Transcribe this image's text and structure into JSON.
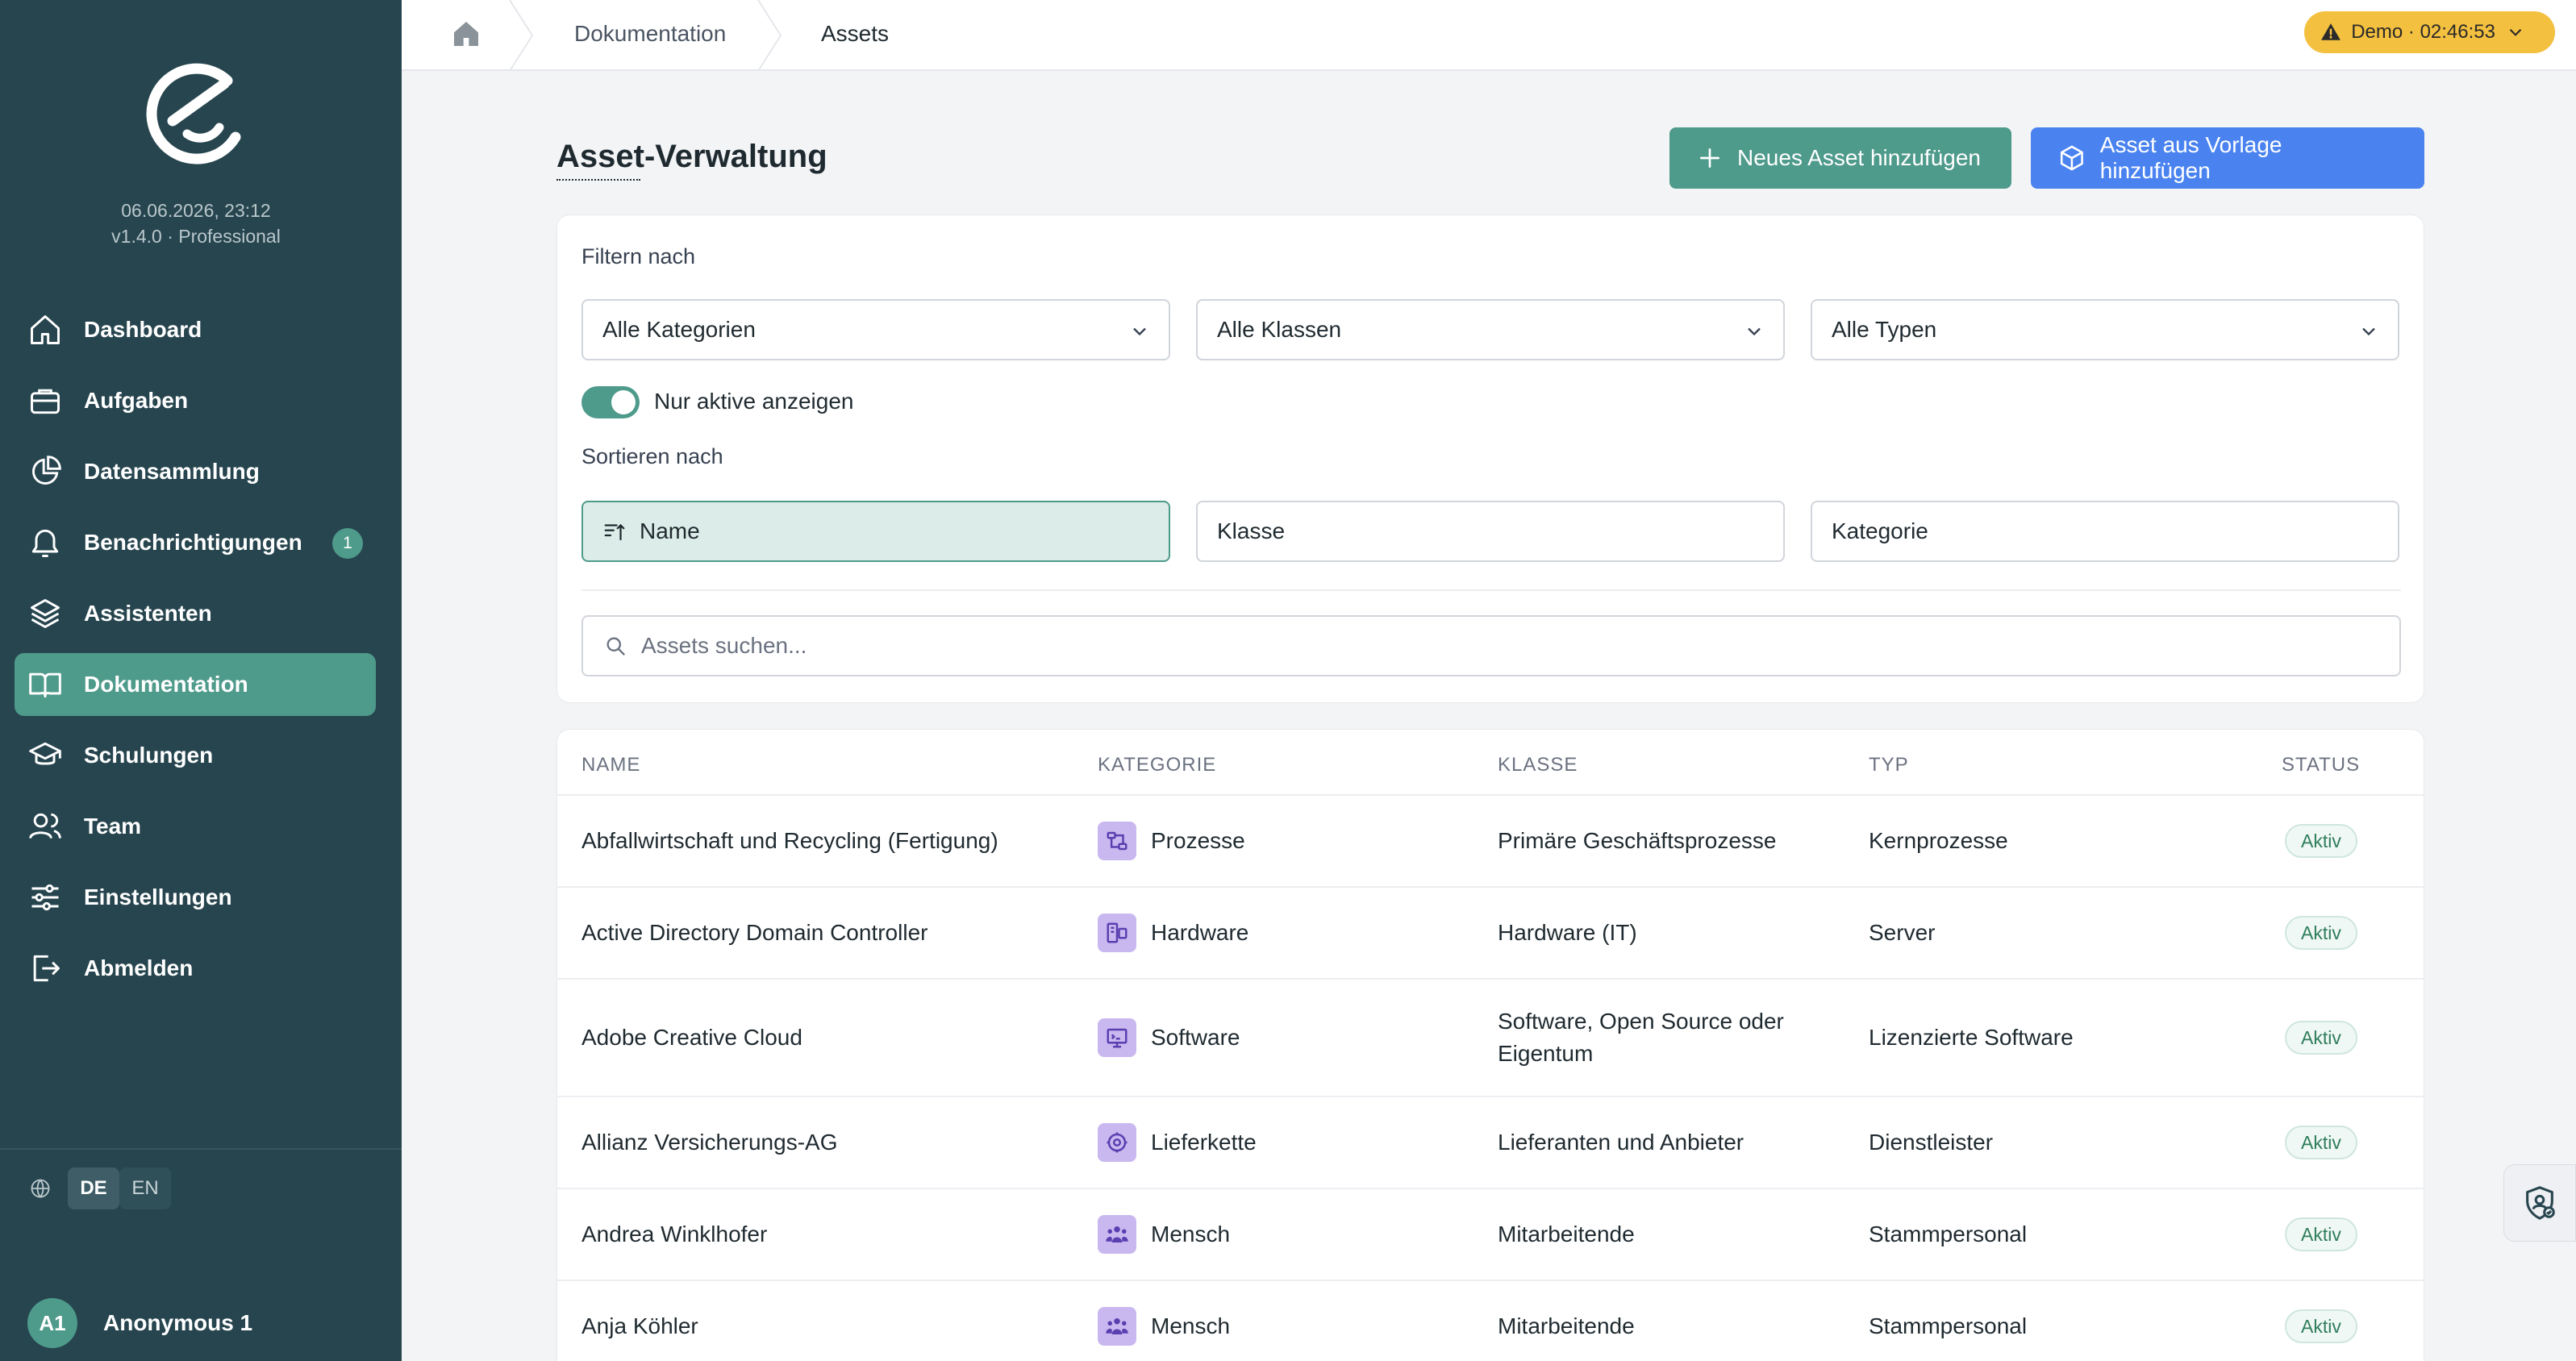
{
  "sidebar": {
    "datetime": "06.06.2026, 23:12",
    "version": "v1.4.0 · Professional",
    "items": [
      {
        "label": "Dashboard",
        "icon": "home-icon"
      },
      {
        "label": "Aufgaben",
        "icon": "briefcase-icon"
      },
      {
        "label": "Datensammlung",
        "icon": "pie-chart-icon"
      },
      {
        "label": "Benachrichtigungen",
        "icon": "bell-icon",
        "badge": "1"
      },
      {
        "label": "Assistenten",
        "icon": "layers-icon"
      },
      {
        "label": "Dokumentation",
        "icon": "book-icon",
        "active": true
      },
      {
        "label": "Schulungen",
        "icon": "graduation-cap-icon"
      },
      {
        "label": "Team",
        "icon": "users-icon"
      },
      {
        "label": "Einstellungen",
        "icon": "sliders-icon"
      },
      {
        "label": "Abmelden",
        "icon": "logout-icon"
      }
    ],
    "languages": [
      "DE",
      "EN"
    ],
    "active_language": "DE",
    "user": {
      "initials": "A1",
      "name": "Anonymous 1"
    }
  },
  "topbar": {
    "breadcrumb": [
      "Dokumentation",
      "Assets"
    ],
    "demo_badge": "Demo · 02:46:53"
  },
  "page": {
    "title": "Asset-Verwaltung",
    "add_button": "Neues Asset hinzufügen",
    "template_button": "Asset aus Vorlage hinzufügen"
  },
  "filters": {
    "label": "Filtern nach",
    "category": "Alle Kategorien",
    "class": "Alle Klassen",
    "type": "Alle Typen",
    "active_only_label": "Nur aktive anzeigen",
    "active_only": true
  },
  "sort": {
    "label": "Sortieren nach",
    "options": [
      "Name",
      "Klasse",
      "Kategorie"
    ],
    "selected": "Name"
  },
  "search": {
    "placeholder": "Assets suchen..."
  },
  "table": {
    "headers": [
      "NAME",
      "KATEGORIE",
      "KLASSE",
      "TYP",
      "STATUS"
    ],
    "rows": [
      {
        "name": "Abfallwirtschaft und Recycling (Fertigung)",
        "category": "Prozesse",
        "class": "Primäre Geschäftsprozesse",
        "type": "Kernprozesse",
        "status": "Aktiv"
      },
      {
        "name": "Active Directory Domain Controller",
        "category": "Hardware",
        "class": "Hardware (IT)",
        "type": "Server",
        "status": "Aktiv"
      },
      {
        "name": "Adobe Creative Cloud",
        "category": "Software",
        "class": "Software, Open Source oder Eigentum",
        "type": "Lizenzierte Software",
        "status": "Aktiv"
      },
      {
        "name": "Allianz Versicherungs-AG",
        "category": "Lieferkette",
        "class": "Lieferanten und Anbieter",
        "type": "Dienstleister",
        "status": "Aktiv"
      },
      {
        "name": "Andrea Winklhofer",
        "category": "Mensch",
        "class": "Mitarbeitende",
        "type": "Stammpersonal",
        "status": "Aktiv"
      },
      {
        "name": "Anja Köhler",
        "category": "Mensch",
        "class": "Mitarbeitende",
        "type": "Stammpersonal",
        "status": "Aktiv"
      }
    ]
  },
  "colors": {
    "sidebar": "#27454f",
    "accent_green": "#4e9a8b",
    "accent_blue": "#4a83f0",
    "demo_yellow": "#f4c03f",
    "category_icon_bg": "#c9b8f0"
  }
}
